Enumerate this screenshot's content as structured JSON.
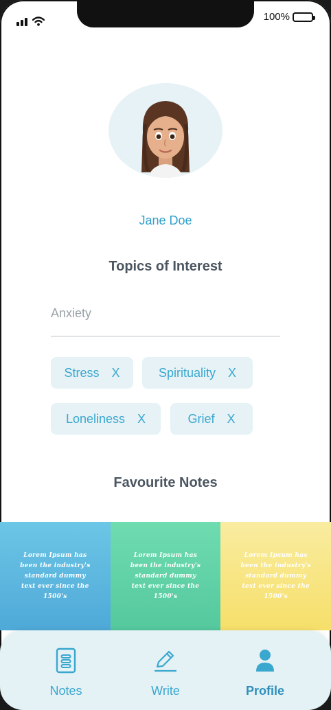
{
  "status_bar": {
    "battery": "100%",
    "icons": [
      "signal-icon",
      "wifi-icon",
      "battery-icon"
    ]
  },
  "profile": {
    "name": "Jane Doe",
    "avatar_icon": "memoji-avatar"
  },
  "topics": {
    "title": "Topics of Interest",
    "input_placeholder": "Anxiety",
    "chips": [
      {
        "label": "Stress",
        "remove": "X"
      },
      {
        "label": "Spirituality",
        "remove": "X"
      },
      {
        "label": "Loneliness",
        "remove": "X"
      },
      {
        "label": "Grief",
        "remove": "X"
      }
    ]
  },
  "favourites": {
    "title": "Favourite Notes",
    "notes": [
      {
        "text": "Lorem Ipsum has been the industry's standard dummy text ever since the 1500's",
        "color": "#5fb8e0"
      },
      {
        "text": "Lorem Ipsum has been the industry's standard dummy text ever since the 1500's",
        "color": "#62d4a8"
      },
      {
        "text": "Lorem Ipsum has been the industry's standard dummy text ever since the 1500's",
        "color": "#f7e585"
      }
    ]
  },
  "tabbar": {
    "tabs": [
      {
        "label": "Notes",
        "icon": "notes-icon",
        "active": false
      },
      {
        "label": "Write",
        "icon": "pencil-icon",
        "active": false
      },
      {
        "label": "Profile",
        "icon": "user-icon",
        "active": true
      }
    ]
  },
  "colors": {
    "accent": "#3aa7cf",
    "chip_bg": "#e6f2f6",
    "tabbar_bg": "#e4f1f5"
  }
}
